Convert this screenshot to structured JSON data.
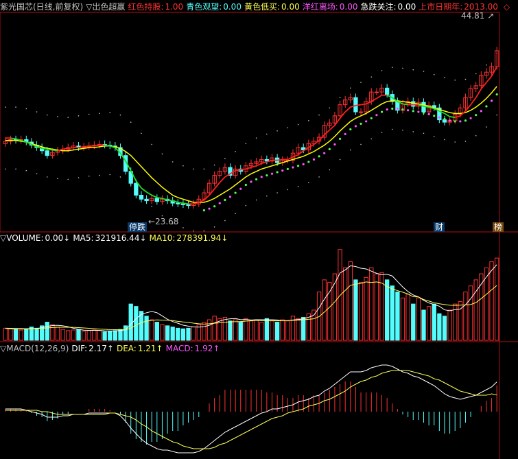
{
  "colors": {
    "background": "#000000",
    "up": "#ff3232",
    "down": "#54fcfc",
    "text": "#c0c0c0",
    "red_label": "#ff3232",
    "cyan_label": "#54fcfc",
    "yellow_label": "#ffff54",
    "magenta_label": "#ff54ff",
    "white": "#ffffff"
  },
  "main_header": {
    "title": "紫光国芯(日线,前复权)",
    "indicator": "▽出色超赢",
    "items": [
      {
        "label": "红色持股:",
        "value": "1.00",
        "color": "#ff3232"
      },
      {
        "label": "青色观望:",
        "value": "0.00",
        "color": "#54fcfc"
      },
      {
        "label": "黄色低买:",
        "value": "0.00",
        "color": "#ffff54"
      },
      {
        "label": "洋红离场:",
        "value": "0.00",
        "color": "#ff54ff"
      },
      {
        "label": "急跌关注:",
        "value": "0.00",
        "color": "#ffffff"
      },
      {
        "label": "上市日期年:",
        "value": "2013.00",
        "color": "#ff3232"
      }
    ],
    "marker": "◇"
  },
  "main_annotations": {
    "high_label": "44.81",
    "low_label": "23.68",
    "stop_drop_label": "停跌",
    "finance_label": "财",
    "rank_label": "榜"
  },
  "volume_header": {
    "prefix": "▽",
    "items": [
      {
        "label": "VOLUME:",
        "value": "0.00",
        "arrow": "↓",
        "color": "#ffffff"
      },
      {
        "label": "MA5:",
        "value": "321916.44",
        "arrow": "↓",
        "color": "#ffffff"
      },
      {
        "label": "MA10:",
        "value": "278391.94",
        "arrow": "↓",
        "color": "#ffff54"
      }
    ]
  },
  "macd_header": {
    "prefix": "▽",
    "name": "MACD(12,26,9)",
    "items": [
      {
        "label": "DIF:",
        "value": "2.17",
        "arrow": "↑",
        "color": "#ffffff"
      },
      {
        "label": "DEA:",
        "value": "1.21",
        "arrow": "↑",
        "color": "#ffff54"
      },
      {
        "label": "MACD:",
        "value": "1.92",
        "arrow": "↑",
        "color": "#ff54ff"
      }
    ]
  },
  "chart_data": {
    "type": "candlestick",
    "title": "紫光国芯(日线,前复权)",
    "price_range": [
      21.5,
      47
    ],
    "close": [
      31.8,
      32.0,
      31.9,
      32.0,
      31.7,
      31.3,
      31.0,
      30.6,
      30.0,
      30.4,
      30.6,
      30.8,
      31.0,
      31.2,
      31.0,
      31.1,
      31.2,
      31.3,
      31.4,
      31.3,
      31.2,
      31.0,
      30.0,
      28.0,
      26.5,
      25.0,
      24.5,
      24.3,
      24.6,
      24.2,
      24.5,
      24.3,
      24.0,
      23.9,
      23.8,
      23.7,
      23.9,
      24.5,
      25.3,
      26.5,
      27.5,
      28.0,
      28.5,
      27.5,
      28.3,
      28.0,
      28.7,
      29.0,
      29.2,
      29.5,
      29.3,
      29.7,
      29.1,
      29.4,
      29.4,
      30.3,
      31.0,
      30.7,
      31.5,
      31.8,
      32.3,
      33.8,
      34.1,
      35.0,
      36.4,
      37.0,
      37.3,
      35.5,
      35.5,
      36.8,
      38.0,
      38.0,
      38.5,
      37.7,
      36.8,
      35.7,
      36.5,
      36.8,
      36.2,
      36.7,
      35.5,
      36.3,
      36.0,
      34.5,
      34.2,
      34.4,
      35.2,
      36.0,
      37.3,
      38.4,
      38.8,
      40.1,
      40.5,
      41.2,
      43.2
    ],
    "ma5": [
      32.2,
      32.2,
      32.1,
      31.9,
      31.7,
      31.4,
      31.1,
      30.9,
      30.8,
      30.7,
      30.6,
      30.8,
      30.9,
      31.0,
      31.0,
      31.1,
      31.2,
      31.2,
      31.3,
      31.3,
      31.2,
      31.0,
      30.3,
      29.3,
      28.1,
      26.8,
      25.9,
      25.4,
      25.0,
      24.7,
      24.6,
      24.4,
      24.3,
      24.1,
      24.0,
      23.9,
      23.9,
      24.1,
      24.4,
      25.0,
      25.8,
      26.6,
      27.3,
      27.7,
      28.1,
      28.2,
      28.3,
      28.5,
      28.7,
      29.0,
      29.2,
      29.4,
      29.4,
      29.5,
      29.5,
      29.8,
      30.1,
      30.6,
      31.0,
      31.4,
      31.9,
      32.6,
      33.2,
      33.8,
      34.7,
      35.5,
      36.1,
      36.3,
      36.4,
      36.5,
      36.8,
      37.2,
      37.6,
      37.6,
      37.3,
      36.8,
      36.5,
      36.4,
      36.4,
      36.4,
      36.2,
      36.1,
      35.9,
      35.6,
      35.3,
      34.9,
      34.8,
      35.0,
      35.6,
      36.4,
      37.3,
      38.4,
      39.2,
      40.0,
      41.2
    ],
    "ma10": [
      31.9,
      31.9,
      31.9,
      31.8,
      31.7,
      31.5,
      31.3,
      31.1,
      30.9,
      30.8,
      30.7,
      30.6,
      30.6,
      30.7,
      30.8,
      30.9,
      31.0,
      31.0,
      31.1,
      31.2,
      31.2,
      31.1,
      30.9,
      30.5,
      30.0,
      29.3,
      28.6,
      27.9,
      27.2,
      26.6,
      26.0,
      25.5,
      25.0,
      24.7,
      24.5,
      24.3,
      24.1,
      24.1,
      24.1,
      24.3,
      24.6,
      25.0,
      25.4,
      25.8,
      26.3,
      26.8,
      27.3,
      27.7,
      28.0,
      28.3,
      28.5,
      28.7,
      28.9,
      29.1,
      29.3,
      29.5,
      29.7,
      29.9,
      30.2,
      30.5,
      30.9,
      31.3,
      31.8,
      32.4,
      33.1,
      33.7,
      34.3,
      34.7,
      35.0,
      35.3,
      35.7,
      36.1,
      36.5,
      36.8,
      36.9,
      36.9,
      36.8,
      36.7,
      36.6,
      36.5,
      36.4,
      36.2,
      36.0,
      35.8,
      35.6,
      35.4,
      35.3,
      35.3,
      35.4,
      35.7,
      36.1,
      36.6,
      37.2,
      37.9,
      38.7
    ],
    "volume": [
      100,
      95,
      90,
      85,
      95,
      110,
      100,
      120,
      150,
      130,
      110,
      90,
      80,
      85,
      90,
      75,
      80,
      85,
      80,
      70,
      75,
      80,
      90,
      120,
      300,
      280,
      240,
      200,
      170,
      150,
      130,
      120,
      110,
      100,
      95,
      100,
      110,
      130,
      150,
      170,
      200,
      180,
      190,
      160,
      170,
      150,
      180,
      160,
      170,
      150,
      180,
      160,
      150,
      170,
      160,
      200,
      180,
      190,
      220,
      250,
      400,
      500,
      480,
      550,
      750,
      600,
      650,
      500,
      480,
      520,
      600,
      550,
      560,
      500,
      450,
      400,
      350,
      380,
      300,
      350,
      250,
      280,
      300,
      220,
      200,
      250,
      300,
      320,
      400,
      450,
      500,
      550,
      600,
      650,
      680
    ],
    "vol_ma5": [
      98,
      96,
      95,
      94,
      93,
      95,
      98,
      104,
      115,
      122,
      124,
      120,
      112,
      100,
      91,
      84,
      82,
      83,
      82,
      78,
      77,
      78,
      81,
      87,
      133,
      178,
      214,
      228,
      238,
      228,
      202,
      174,
      155,
      141,
      125,
      117,
      111,
      109,
      113,
      124,
      144,
      159,
      172,
      178,
      180,
      171,
      172,
      168,
      170,
      170,
      170,
      170,
      168,
      161,
      163,
      168,
      172,
      178,
      190,
      208,
      268,
      340,
      400,
      472,
      556,
      582,
      616,
      610,
      596,
      590,
      572,
      554,
      542,
      546,
      532,
      486,
      441,
      403,
      375,
      359,
      331,
      309,
      296,
      282,
      252,
      244,
      254,
      258,
      294,
      344,
      404,
      464,
      524,
      578,
      626
    ],
    "vol_ma10": [
      100,
      99,
      98,
      97,
      96,
      97,
      98,
      99,
      102,
      106,
      108,
      108,
      108,
      107,
      105,
      102,
      99,
      96,
      93,
      91,
      89,
      88,
      87,
      87,
      101,
      125,
      147,
      158,
      165,
      169,
      167,
      166,
      163,
      157,
      152,
      148,
      142,
      137,
      134,
      137,
      141,
      145,
      149,
      153,
      154,
      155,
      159,
      162,
      165,
      163,
      163,
      162,
      161,
      162,
      163,
      165,
      167,
      170,
      174,
      178,
      196,
      233,
      274,
      318,
      371,
      413,
      455,
      464,
      471,
      483,
      478,
      483,
      474,
      444,
      424,
      411,
      398,
      383,
      360,
      359,
      337,
      325,
      311,
      302,
      296,
      290,
      289,
      291,
      293,
      296,
      312,
      345,
      381,
      418,
      453
    ],
    "dif": [
      0.2,
      0.2,
      0.2,
      0.2,
      0.1,
      0.0,
      -0.1,
      -0.2,
      -0.4,
      -0.4,
      -0.4,
      -0.3,
      -0.3,
      -0.2,
      -0.2,
      -0.2,
      -0.1,
      -0.1,
      -0.1,
      -0.1,
      -0.1,
      -0.1,
      -0.3,
      -0.7,
      -1.2,
      -1.6,
      -2.0,
      -2.3,
      -2.5,
      -2.7,
      -2.8,
      -2.8,
      -2.9,
      -3.0,
      -3.0,
      -3.0,
      -3.0,
      -2.9,
      -2.7,
      -2.4,
      -2.1,
      -1.8,
      -1.5,
      -1.3,
      -1.1,
      -0.9,
      -0.7,
      -0.5,
      -0.3,
      -0.1,
      0.0,
      0.2,
      0.2,
      0.3,
      0.4,
      0.5,
      0.7,
      0.8,
      0.9,
      1.1,
      1.2,
      1.5,
      1.7,
      2.0,
      2.3,
      2.6,
      2.9,
      2.9,
      2.9,
      3.0,
      3.2,
      3.3,
      3.4,
      3.4,
      3.3,
      3.1,
      2.9,
      2.8,
      2.6,
      2.5,
      2.3,
      2.1,
      1.9,
      1.6,
      1.3,
      1.1,
      1.0,
      0.9,
      1.0,
      1.1,
      1.2,
      1.4,
      1.6,
      1.8,
      2.17
    ],
    "dea": [
      0.1,
      0.1,
      0.1,
      0.1,
      0.1,
      0.1,
      0.1,
      0.0,
      0.0,
      -0.1,
      -0.2,
      -0.2,
      -0.2,
      -0.2,
      -0.2,
      -0.2,
      -0.2,
      -0.2,
      -0.2,
      -0.2,
      -0.1,
      -0.1,
      -0.2,
      -0.3,
      -0.4,
      -0.6,
      -0.9,
      -1.1,
      -1.4,
      -1.6,
      -1.8,
      -2.0,
      -2.2,
      -2.3,
      -2.5,
      -2.6,
      -2.7,
      -2.7,
      -2.7,
      -2.7,
      -2.6,
      -2.4,
      -2.3,
      -2.1,
      -1.9,
      -1.7,
      -1.5,
      -1.3,
      -1.1,
      -0.9,
      -0.7,
      -0.5,
      -0.4,
      -0.3,
      -0.1,
      0.0,
      0.1,
      0.2,
      0.4,
      0.5,
      0.6,
      0.8,
      0.9,
      1.1,
      1.3,
      1.5,
      1.8,
      2.0,
      2.2,
      2.3,
      2.5,
      2.6,
      2.8,
      2.9,
      3.0,
      3.0,
      3.0,
      3.0,
      2.9,
      2.8,
      2.7,
      2.6,
      2.4,
      2.3,
      2.1,
      1.9,
      1.7,
      1.5,
      1.4,
      1.3,
      1.2,
      1.2,
      1.2,
      1.3,
      1.21
    ],
    "macd_hist": [
      0.2,
      0.2,
      0.2,
      0.2,
      0.1,
      -0.1,
      -0.3,
      -0.4,
      -0.7,
      -0.6,
      -0.5,
      -0.2,
      -0.2,
      0.0,
      0.0,
      0.0,
      0.2,
      0.2,
      0.2,
      0.2,
      0.1,
      0.0,
      -0.2,
      -0.8,
      -1.6,
      -2.0,
      -2.2,
      -2.4,
      -2.2,
      -2.2,
      -2.0,
      -1.6,
      -1.4,
      -1.4,
      -1.0,
      -0.8,
      -0.6,
      -0.4,
      0.0,
      0.6,
      1.0,
      1.2,
      1.6,
      1.6,
      1.6,
      1.6,
      1.6,
      1.6,
      1.6,
      1.6,
      1.4,
      1.4,
      1.2,
      1.2,
      1.0,
      1.0,
      1.2,
      1.2,
      1.0,
      1.2,
      1.2,
      1.4,
      1.6,
      1.8,
      2.0,
      2.2,
      2.2,
      1.8,
      1.4,
      1.4,
      1.4,
      1.4,
      1.2,
      1.0,
      0.6,
      0.2,
      -0.2,
      -0.4,
      -0.6,
      -0.6,
      -0.8,
      -1.0,
      -1.0,
      -1.4,
      -1.6,
      -1.6,
      -1.4,
      -1.2,
      -0.8,
      -0.4,
      0.0,
      0.4,
      0.8,
      1.0,
      1.92
    ]
  }
}
